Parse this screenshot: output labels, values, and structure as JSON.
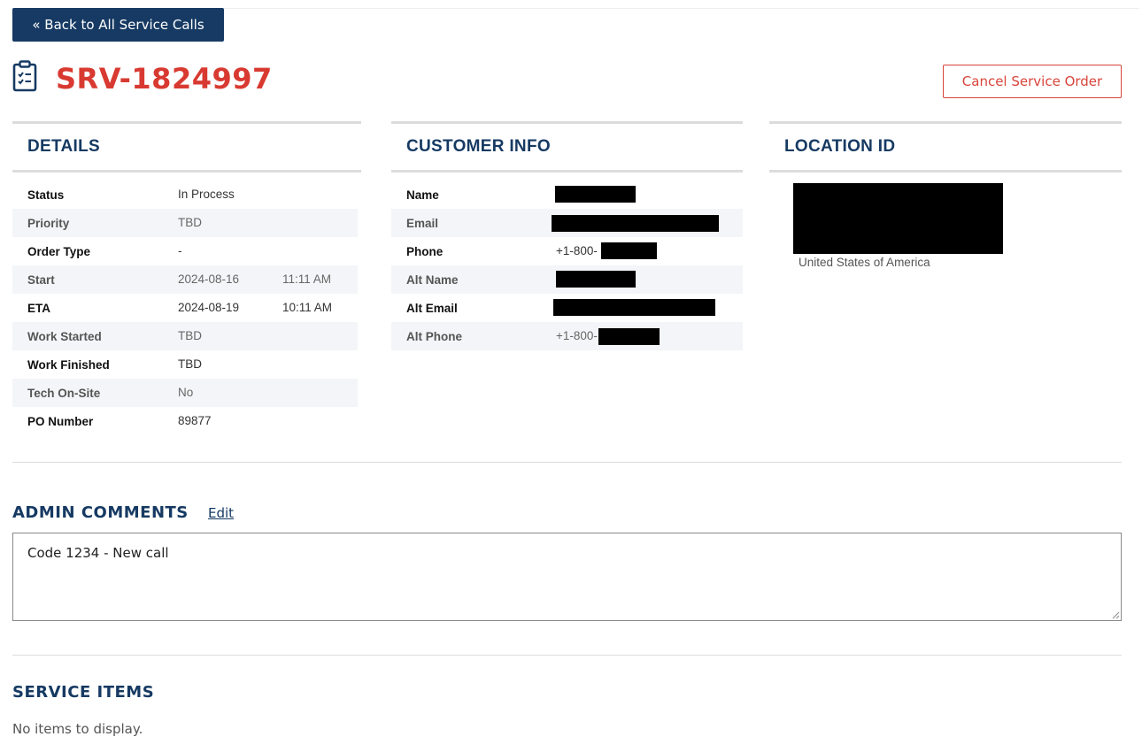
{
  "nav": {
    "back_label": "« Back to All Service Calls"
  },
  "header": {
    "title": "SRV-1824997",
    "icon": "clipboard-checklist-icon",
    "cancel_label": "Cancel Service Order",
    "title_color": "#d83a31",
    "accent_color": "#163a63"
  },
  "details": {
    "heading": "DETAILS",
    "rows": [
      {
        "label": "Status",
        "value": "In Process",
        "time": ""
      },
      {
        "label": "Priority",
        "value": "TBD",
        "time": ""
      },
      {
        "label": "Order Type",
        "value": "-",
        "time": ""
      },
      {
        "label": "Start",
        "value": "2024-08-16",
        "time": "11:11 AM"
      },
      {
        "label": "ETA",
        "value": "2024-08-19",
        "time": "10:11 AM"
      },
      {
        "label": "Work Started",
        "value": "TBD",
        "time": ""
      },
      {
        "label": "Work Finished",
        "value": "TBD",
        "time": ""
      },
      {
        "label": "Tech On-Site",
        "value": "No",
        "time": ""
      },
      {
        "label": "PO Number",
        "value": "89877",
        "time": ""
      }
    ]
  },
  "customer": {
    "heading": "CUSTOMER INFO",
    "rows": [
      {
        "label": "Name",
        "value": ""
      },
      {
        "label": "Email",
        "value": ""
      },
      {
        "label": "Phone",
        "value": "+1-800-"
      },
      {
        "label": "Alt Name",
        "value": ""
      },
      {
        "label": "Alt Email",
        "value": ""
      },
      {
        "label": "Alt Phone",
        "value": "+1-800-"
      }
    ]
  },
  "location": {
    "heading": "LOCATION ID",
    "country": "United States of America"
  },
  "admin_comments": {
    "heading": "ADMIN COMMENTS",
    "edit_label": "Edit",
    "text": "Code 1234 - New call"
  },
  "service_items": {
    "heading": "SERVICE ITEMS",
    "empty_text": "No items to display."
  }
}
